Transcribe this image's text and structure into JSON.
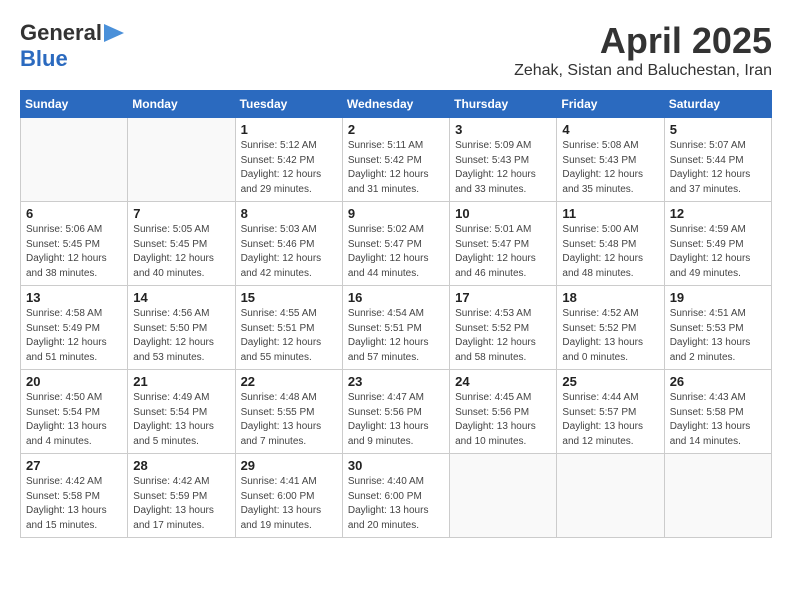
{
  "header": {
    "logo_line1": "General",
    "logo_line2": "Blue",
    "title": "April 2025",
    "subtitle": "Zehak, Sistan and Baluchestan, Iran"
  },
  "days_of_week": [
    "Sunday",
    "Monday",
    "Tuesday",
    "Wednesday",
    "Thursday",
    "Friday",
    "Saturday"
  ],
  "weeks": [
    [
      {
        "day": "",
        "info": ""
      },
      {
        "day": "",
        "info": ""
      },
      {
        "day": "1",
        "info": "Sunrise: 5:12 AM\nSunset: 5:42 PM\nDaylight: 12 hours\nand 29 minutes."
      },
      {
        "day": "2",
        "info": "Sunrise: 5:11 AM\nSunset: 5:42 PM\nDaylight: 12 hours\nand 31 minutes."
      },
      {
        "day": "3",
        "info": "Sunrise: 5:09 AM\nSunset: 5:43 PM\nDaylight: 12 hours\nand 33 minutes."
      },
      {
        "day": "4",
        "info": "Sunrise: 5:08 AM\nSunset: 5:43 PM\nDaylight: 12 hours\nand 35 minutes."
      },
      {
        "day": "5",
        "info": "Sunrise: 5:07 AM\nSunset: 5:44 PM\nDaylight: 12 hours\nand 37 minutes."
      }
    ],
    [
      {
        "day": "6",
        "info": "Sunrise: 5:06 AM\nSunset: 5:45 PM\nDaylight: 12 hours\nand 38 minutes."
      },
      {
        "day": "7",
        "info": "Sunrise: 5:05 AM\nSunset: 5:45 PM\nDaylight: 12 hours\nand 40 minutes."
      },
      {
        "day": "8",
        "info": "Sunrise: 5:03 AM\nSunset: 5:46 PM\nDaylight: 12 hours\nand 42 minutes."
      },
      {
        "day": "9",
        "info": "Sunrise: 5:02 AM\nSunset: 5:47 PM\nDaylight: 12 hours\nand 44 minutes."
      },
      {
        "day": "10",
        "info": "Sunrise: 5:01 AM\nSunset: 5:47 PM\nDaylight: 12 hours\nand 46 minutes."
      },
      {
        "day": "11",
        "info": "Sunrise: 5:00 AM\nSunset: 5:48 PM\nDaylight: 12 hours\nand 48 minutes."
      },
      {
        "day": "12",
        "info": "Sunrise: 4:59 AM\nSunset: 5:49 PM\nDaylight: 12 hours\nand 49 minutes."
      }
    ],
    [
      {
        "day": "13",
        "info": "Sunrise: 4:58 AM\nSunset: 5:49 PM\nDaylight: 12 hours\nand 51 minutes."
      },
      {
        "day": "14",
        "info": "Sunrise: 4:56 AM\nSunset: 5:50 PM\nDaylight: 12 hours\nand 53 minutes."
      },
      {
        "day": "15",
        "info": "Sunrise: 4:55 AM\nSunset: 5:51 PM\nDaylight: 12 hours\nand 55 minutes."
      },
      {
        "day": "16",
        "info": "Sunrise: 4:54 AM\nSunset: 5:51 PM\nDaylight: 12 hours\nand 57 minutes."
      },
      {
        "day": "17",
        "info": "Sunrise: 4:53 AM\nSunset: 5:52 PM\nDaylight: 12 hours\nand 58 minutes."
      },
      {
        "day": "18",
        "info": "Sunrise: 4:52 AM\nSunset: 5:52 PM\nDaylight: 13 hours\nand 0 minutes."
      },
      {
        "day": "19",
        "info": "Sunrise: 4:51 AM\nSunset: 5:53 PM\nDaylight: 13 hours\nand 2 minutes."
      }
    ],
    [
      {
        "day": "20",
        "info": "Sunrise: 4:50 AM\nSunset: 5:54 PM\nDaylight: 13 hours\nand 4 minutes."
      },
      {
        "day": "21",
        "info": "Sunrise: 4:49 AM\nSunset: 5:54 PM\nDaylight: 13 hours\nand 5 minutes."
      },
      {
        "day": "22",
        "info": "Sunrise: 4:48 AM\nSunset: 5:55 PM\nDaylight: 13 hours\nand 7 minutes."
      },
      {
        "day": "23",
        "info": "Sunrise: 4:47 AM\nSunset: 5:56 PM\nDaylight: 13 hours\nand 9 minutes."
      },
      {
        "day": "24",
        "info": "Sunrise: 4:45 AM\nSunset: 5:56 PM\nDaylight: 13 hours\nand 10 minutes."
      },
      {
        "day": "25",
        "info": "Sunrise: 4:44 AM\nSunset: 5:57 PM\nDaylight: 13 hours\nand 12 minutes."
      },
      {
        "day": "26",
        "info": "Sunrise: 4:43 AM\nSunset: 5:58 PM\nDaylight: 13 hours\nand 14 minutes."
      }
    ],
    [
      {
        "day": "27",
        "info": "Sunrise: 4:42 AM\nSunset: 5:58 PM\nDaylight: 13 hours\nand 15 minutes."
      },
      {
        "day": "28",
        "info": "Sunrise: 4:42 AM\nSunset: 5:59 PM\nDaylight: 13 hours\nand 17 minutes."
      },
      {
        "day": "29",
        "info": "Sunrise: 4:41 AM\nSunset: 6:00 PM\nDaylight: 13 hours\nand 19 minutes."
      },
      {
        "day": "30",
        "info": "Sunrise: 4:40 AM\nSunset: 6:00 PM\nDaylight: 13 hours\nand 20 minutes."
      },
      {
        "day": "",
        "info": ""
      },
      {
        "day": "",
        "info": ""
      },
      {
        "day": "",
        "info": ""
      }
    ]
  ]
}
